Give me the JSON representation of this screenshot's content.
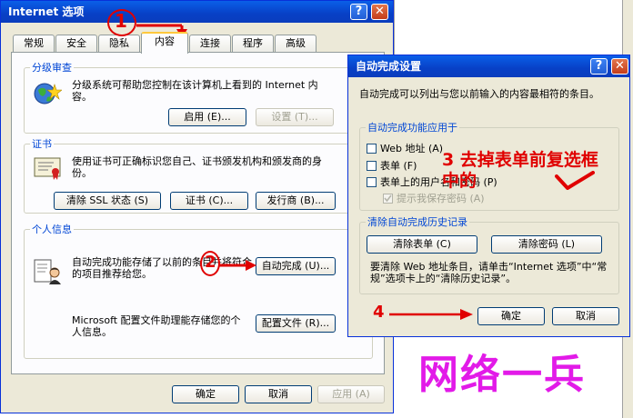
{
  "main_window": {
    "title": "Internet 选项",
    "tabs": [
      {
        "label": "常规"
      },
      {
        "label": "安全"
      },
      {
        "label": "隐私"
      },
      {
        "label": "内容"
      },
      {
        "label": "连接"
      },
      {
        "label": "程序"
      },
      {
        "label": "高级"
      }
    ],
    "content_advisor": {
      "group_label": "分级审查",
      "text": "分级系统可帮助您控制在该计算机上看到的 Internet 内容。",
      "enable_button": "启用 (E)...",
      "settings_button": "设置 (T)..."
    },
    "certificates": {
      "group_label": "证书",
      "text": "使用证书可正确标识您自己、证书颁发机构和颁发商的身份。",
      "clear_ssl_button": "清除 SSL 状态 (S)",
      "certificates_button": "证书 (C)...",
      "publishers_button": "发行商 (B)..."
    },
    "personal_info": {
      "group_label": "个人信息",
      "autocomplete_text": "自动完成功能存储了以前的条目并将符合的项目推荐给您。",
      "autocomplete_button": "自动完成 (U)...",
      "profile_text": "Microsoft 配置文件助理能存储您的个人信息。",
      "profile_button": "配置文件 (R)..."
    },
    "ok_button": "确定",
    "cancel_button": "取消",
    "apply_button": "应用 (A)"
  },
  "autocomplete_dialog": {
    "title": "自动完成设置",
    "description": "自动完成可以列出与您以前输入的内容最相符的条目。",
    "use_for_group_label": "自动完成功能应用于",
    "options": [
      {
        "label": "Web 地址 (A)",
        "checked": false
      },
      {
        "label": "表单 (F)",
        "checked": false
      },
      {
        "label": "表单上的用户名和密码 (P)",
        "checked": false
      }
    ],
    "prompt_save_password": "提示我保存密码 (A)",
    "clear_history_group_label": "清除自动完成历史记录",
    "clear_forms_button": "清除表单 (C)",
    "clear_passwords_button": "清除密码 (L)",
    "clear_note": "要清除 Web 地址条目，请单击“Internet 选项”中“常规”选项卡上的“清除历史记录”。",
    "ok_button": "确定",
    "cancel_button": "取消"
  },
  "annotations": {
    "step1": "1",
    "step2": "2",
    "step3": "3 去掉表单前复选框中的",
    "step4": "4",
    "watermark": "网络一兵",
    "annotation_color": "#e00000",
    "watermark_color": "#e21ae8"
  }
}
